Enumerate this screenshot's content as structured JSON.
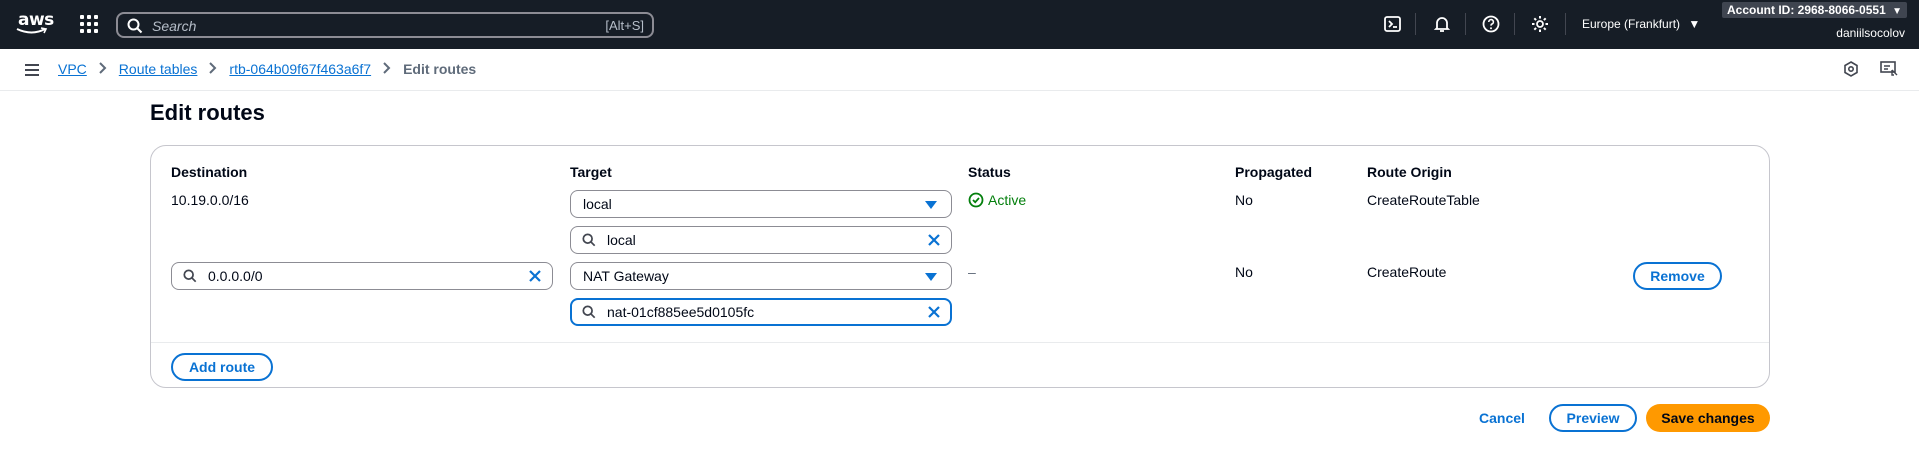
{
  "topnav": {
    "logo_text": "aws",
    "search_placeholder": "Search",
    "search_shortcut": "[Alt+S]",
    "icons": [
      "cloudshell-icon",
      "bell-icon",
      "help-icon",
      "gear-icon"
    ],
    "region": "Europe (Frankfurt)",
    "account": "Account ID: 2968-8066-0551",
    "username": "daniilsocolov"
  },
  "breadcrumb": {
    "items": [
      "VPC",
      "Route tables",
      "rtb-064b09f67f463a6f7"
    ],
    "current": "Edit routes"
  },
  "page": {
    "title": "Edit routes"
  },
  "table": {
    "headers": [
      "Destination",
      "Target",
      "Status",
      "Propagated",
      "Route Origin"
    ],
    "rows": [
      {
        "destination": "10.19.0.0/16",
        "target_type": "local",
        "target_value": "local",
        "status": "Active",
        "propagated": "No",
        "origin": "CreateRouteTable"
      },
      {
        "destination": "0.0.0.0/0",
        "target_type": "NAT Gateway",
        "target_value": "nat-01cf885ee5d0105fc",
        "status": "–",
        "propagated": "No",
        "origin": "CreateRoute",
        "remove_label": "Remove"
      }
    ]
  },
  "actions": {
    "add_route": "Add route",
    "cancel": "Cancel",
    "preview": "Preview",
    "save": "Save changes"
  },
  "colors": {
    "nav_bg": "#161d26",
    "link": "#0972d3",
    "primary": "#ff9900",
    "success": "#037f0c"
  }
}
